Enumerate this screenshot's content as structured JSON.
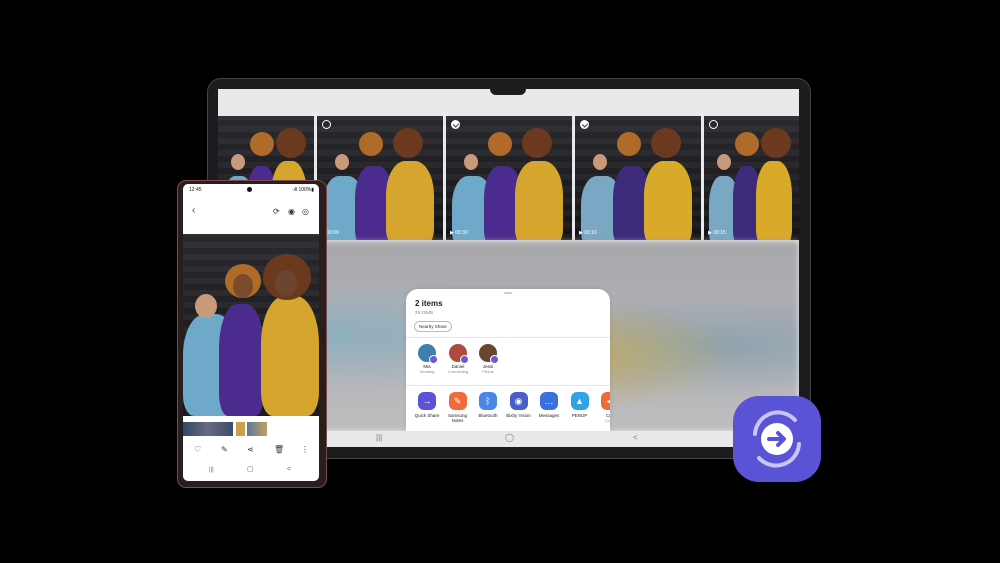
{
  "phone": {
    "status_time": "12:45",
    "status_right": "·ıll 100%▮",
    "toolbar": {
      "back_icon": "chevron-left-icon",
      "icons": [
        "remaster-icon",
        "eye-icon",
        "nearby-icon"
      ]
    },
    "actions": [
      "heart-icon",
      "edit-icon",
      "share-icon",
      "delete-icon",
      "more-icon"
    ],
    "nav": [
      "|||",
      "▢",
      "<"
    ]
  },
  "tablet": {
    "thumbnails": [
      {
        "selected": null,
        "duration": ""
      },
      {
        "selected": false,
        "duration": "00:09"
      },
      {
        "selected": true,
        "duration": "00:30"
      },
      {
        "selected": true,
        "duration": "00:10"
      },
      {
        "selected": false,
        "duration": "00:15"
      }
    ],
    "nav": [
      "|||",
      "◯",
      "<"
    ]
  },
  "share_sheet": {
    "title": "2 items",
    "size": "29.22MB",
    "chip": "Nearby Share",
    "contacts": [
      {
        "name": "Mia",
        "status": "Sending",
        "color": "#3f7fb0"
      },
      {
        "name": "Daniel",
        "status": "Connecting",
        "color": "#b04a3f"
      },
      {
        "name": "Jessi",
        "status": "Phone",
        "color": "#6b4530"
      }
    ],
    "apps": [
      {
        "name": "Quick Share",
        "color": "#5b53d6",
        "glyph": "→"
      },
      {
        "name": "Samsung Notes",
        "color": "#f06a3a",
        "glyph": "✎"
      },
      {
        "name": "Bluetooth",
        "color": "#4a86e8",
        "glyph": "ᛒ"
      },
      {
        "name": "Bixby Vision",
        "color": "#4a5ec9",
        "glyph": "◉"
      },
      {
        "name": "Messages",
        "color": "#3a6fe0",
        "glyph": "…"
      },
      {
        "name": "PENUP",
        "color": "#2fa3e6",
        "glyph": "▲"
      },
      {
        "name": "Con",
        "sub": "Conn",
        "color": "#f06a3a",
        "glyph": "◀"
      }
    ]
  },
  "logo": {
    "name": "quick-share-logo",
    "color": "#5b53d6"
  }
}
